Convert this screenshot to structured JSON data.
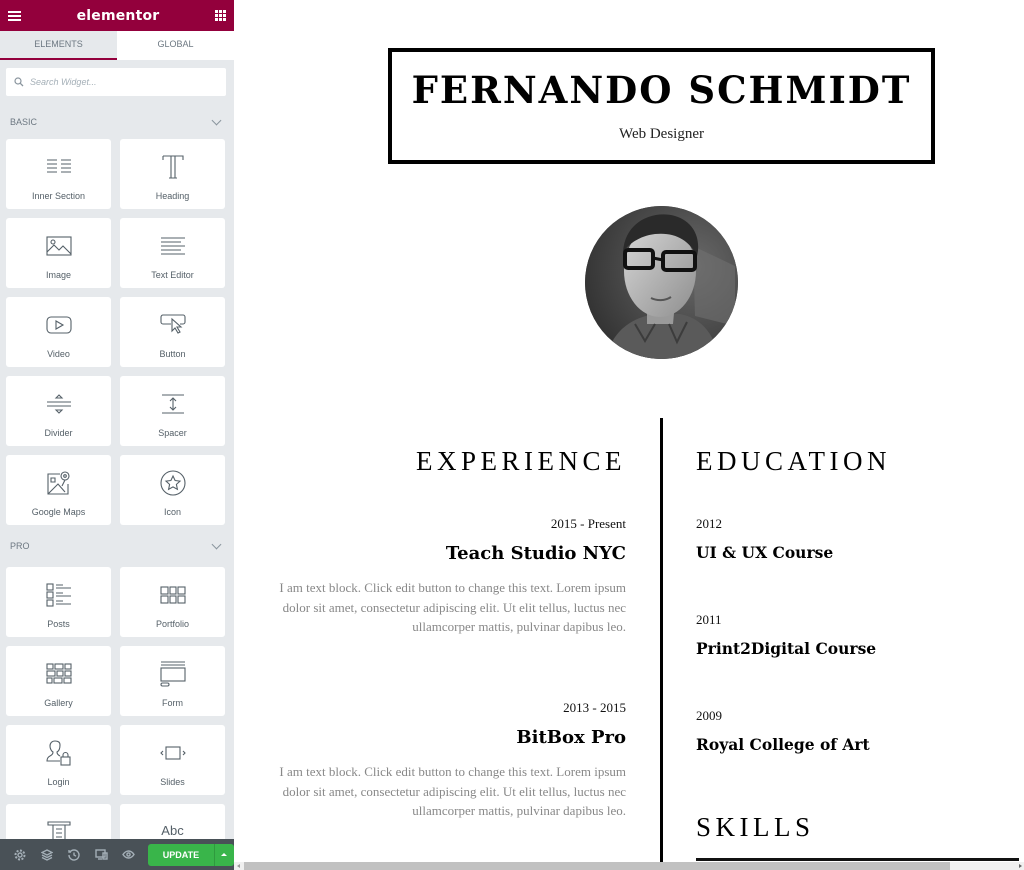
{
  "editor": {
    "app_title": "elementor",
    "tabs": [
      {
        "label": "ELEMENTS",
        "active": true
      },
      {
        "label": "GLOBAL",
        "active": false
      }
    ],
    "search": {
      "placeholder": "Search Widget...",
      "value": ""
    },
    "categories": [
      {
        "title": "BASIC",
        "expanded": true,
        "widgets": [
          {
            "label": "Inner Section",
            "icon": "inner-section-icon"
          },
          {
            "label": "Heading",
            "icon": "heading-icon"
          },
          {
            "label": "Image",
            "icon": "image-icon"
          },
          {
            "label": "Text Editor",
            "icon": "text-editor-icon"
          },
          {
            "label": "Video",
            "icon": "video-icon"
          },
          {
            "label": "Button",
            "icon": "button-icon"
          },
          {
            "label": "Divider",
            "icon": "divider-icon"
          },
          {
            "label": "Spacer",
            "icon": "spacer-icon"
          },
          {
            "label": "Google Maps",
            "icon": "google-maps-icon"
          },
          {
            "label": "Icon",
            "icon": "star-icon"
          }
        ]
      },
      {
        "title": "PRO",
        "expanded": true,
        "widgets": [
          {
            "label": "Posts",
            "icon": "posts-icon"
          },
          {
            "label": "Portfolio",
            "icon": "portfolio-icon"
          },
          {
            "label": "Gallery",
            "icon": "gallery-icon"
          },
          {
            "label": "Form",
            "icon": "form-icon"
          },
          {
            "label": "Login",
            "icon": "login-icon"
          },
          {
            "label": "Slides",
            "icon": "slides-icon"
          },
          {
            "label": "",
            "icon": "nav-menu-icon"
          },
          {
            "label": "",
            "icon": "animated-headline-icon",
            "glyph_text": "Abc"
          }
        ]
      }
    ],
    "footer": {
      "icons": [
        "settings-icon",
        "navigator-icon",
        "history-icon",
        "responsive-mode-icon",
        "preview-icon"
      ],
      "update_label": "UPDATE"
    },
    "colors": {
      "brand": "#93003c",
      "panel_bg": "#e6e9ec",
      "footer_bg": "#495157",
      "update_green": "#39b54a"
    }
  },
  "page": {
    "name": "FERNANDO SCHMIDT",
    "role": "Web Designer",
    "avatar_alt": "Black and white portrait of a man with glasses",
    "experience": {
      "title": "EXPERIENCE",
      "items": [
        {
          "dates": "2015 - Present",
          "company": "Teach Studio NYC",
          "description": "I am text block. Click edit button to change this text. Lorem ipsum dolor sit amet, consectetur adipiscing elit. Ut elit tellus, luctus nec ullamcorper mattis, pulvinar dapibus leo."
        },
        {
          "dates": "2013 - 2015",
          "company": "BitBox Pro",
          "description": "I am text block. Click edit button to change this text. Lorem ipsum dolor sit amet, consectetur adipiscing elit. Ut elit tellus, luctus nec ullamcorper mattis, pulvinar dapibus leo."
        }
      ]
    },
    "education": {
      "title": "EDUCATION",
      "items": [
        {
          "year": "2012",
          "course": "UI & UX Course"
        },
        {
          "year": "2011",
          "course": "Print2Digital Course"
        },
        {
          "year": "2009",
          "course": "Royal College of Art"
        }
      ]
    },
    "skills": {
      "title": "SKILLS"
    }
  }
}
